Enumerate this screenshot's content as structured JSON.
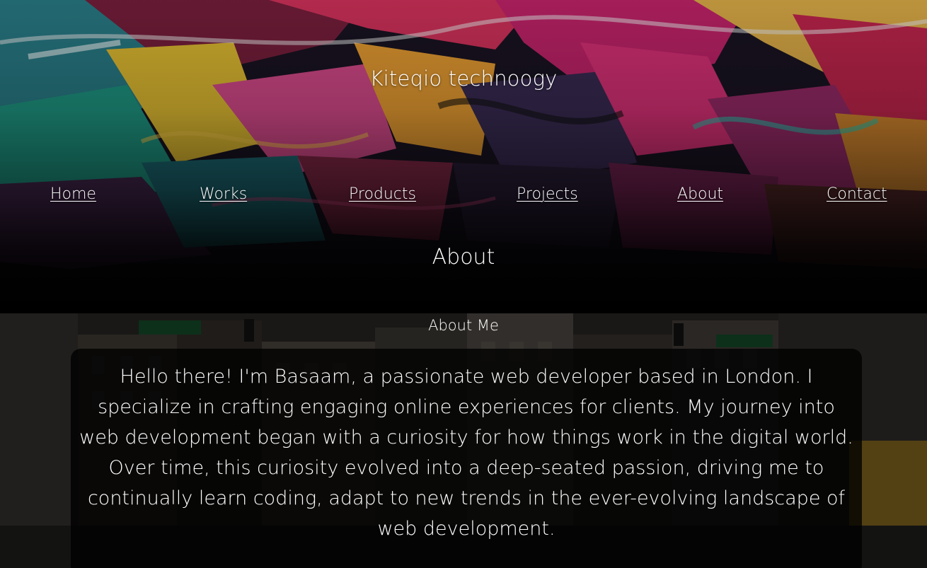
{
  "site": {
    "title": "Kiteqio technoogy"
  },
  "nav": {
    "items": [
      {
        "label": "Home"
      },
      {
        "label": "Works"
      },
      {
        "label": "Products"
      },
      {
        "label": "Projects"
      },
      {
        "label": "About"
      },
      {
        "label": "Contact"
      }
    ]
  },
  "page": {
    "heading": "About"
  },
  "about": {
    "section_title": "About Me",
    "body": "Hello there! I'm Basaam, a passionate web developer based in London. I specialize in crafting engaging online experiences for clients. My journey into web development began with a curiosity for how things work in the digital world. Over time, this curiosity evolved into a deep-seated passion, driving me to continually learn coding, adapt to new trends in the ever-evolving landscape of web development."
  },
  "colors": {
    "text": "#ffffff",
    "background": "#000000",
    "card": "#000000"
  }
}
